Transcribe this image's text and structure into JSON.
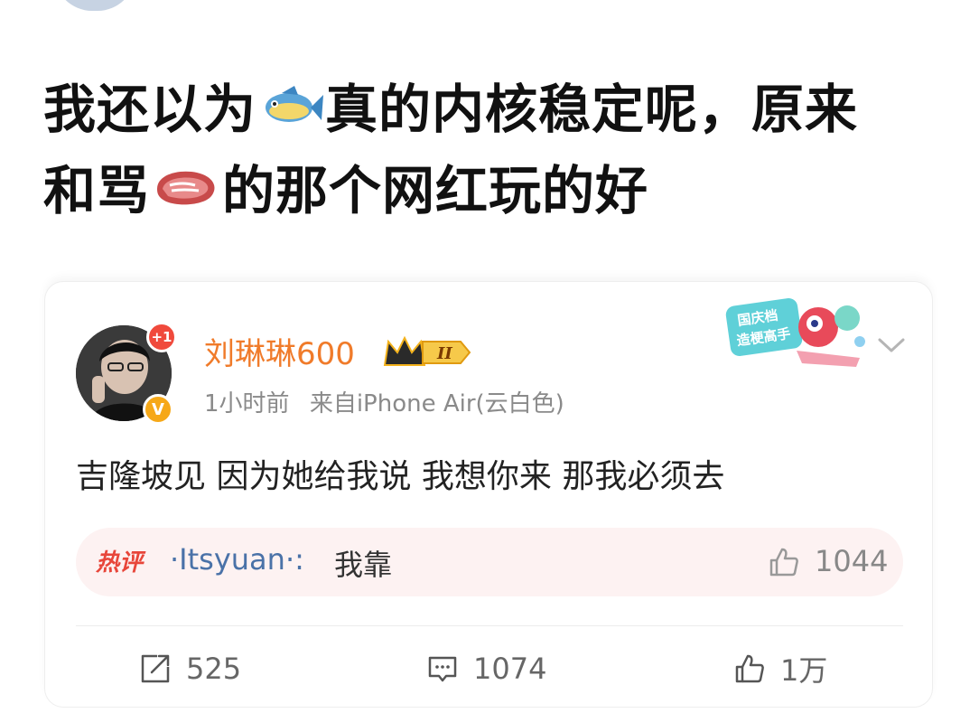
{
  "post": {
    "line1_a": "我还以为",
    "line1_b": "真的内核稳定呢，原来",
    "line2_a": "和骂",
    "line2_b": "的那个网红玩的好",
    "emoji_1": "fish-icon",
    "emoji_2": "steak-icon"
  },
  "comment_card": {
    "username": "刘琳琳600",
    "level_badge": "II",
    "plus_badge": "+1",
    "verified_badge": "V",
    "time": "1小时前",
    "source": "来自iPhone Air(云白色)",
    "promo_badge": {
      "line1": "国庆档",
      "line2": "造梗高手"
    },
    "text": "吉隆坡见 因为她给我说 我想你来 那我必须去",
    "hot_comment": {
      "label": "热评",
      "user": "·Itsyuan·:",
      "content": "我靠",
      "likes": "1044"
    },
    "actions": {
      "share_count": "525",
      "comment_count": "1074",
      "like_count": "1万"
    }
  },
  "colors": {
    "username": "#f07b2a",
    "hot_label": "#e8463a",
    "hot_bg": "#fdf2f2",
    "link_user": "#4a72a8"
  }
}
